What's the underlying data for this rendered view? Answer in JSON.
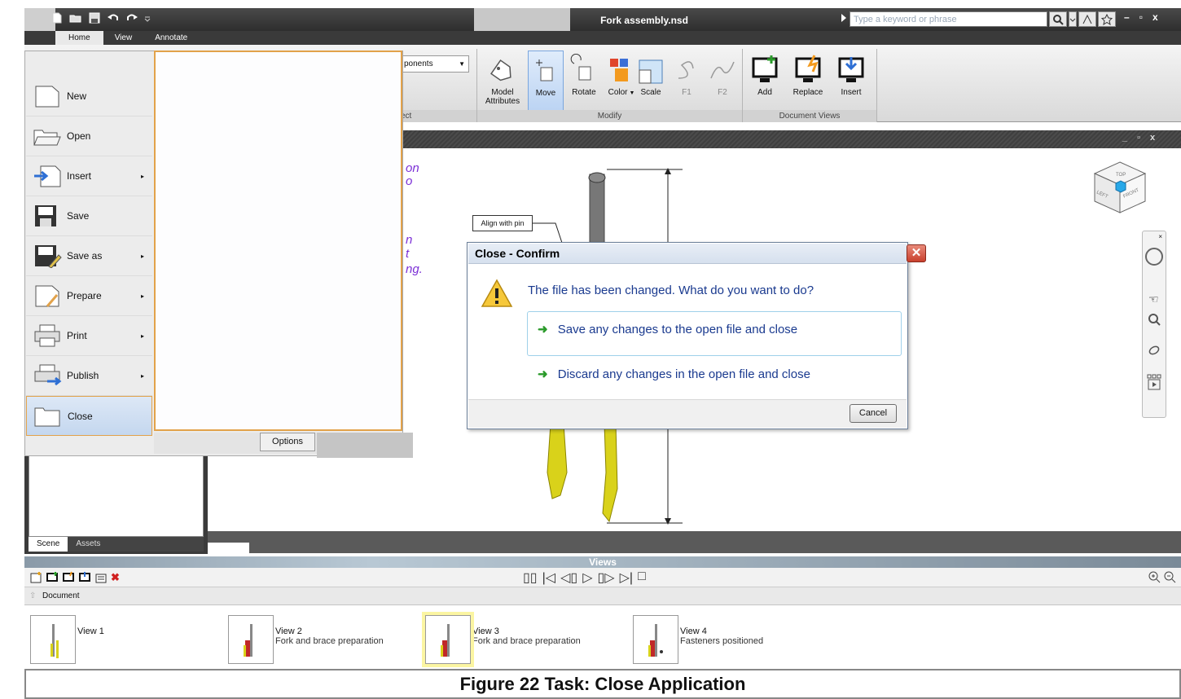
{
  "window": {
    "title": "Fork assembly.nsd",
    "search_placeholder": "Type a keyword or phrase"
  },
  "ribbon": {
    "tabs": [
      {
        "label": "Home"
      },
      {
        "label": "View"
      },
      {
        "label": "Annotate"
      }
    ],
    "components_combo": "ponents",
    "select_group_label_fragment": "ect",
    "modify_group": {
      "label": "Modify",
      "buttons": [
        {
          "label": "Model\nAttributes"
        },
        {
          "label": "Move"
        },
        {
          "label": "Rotate"
        },
        {
          "label": "Color"
        },
        {
          "label": "Scale"
        },
        {
          "label": "F1"
        },
        {
          "label": "F2"
        }
      ]
    },
    "document_views_group": {
      "label": "Document Views",
      "buttons": [
        {
          "label": "Add"
        },
        {
          "label": "Replace"
        },
        {
          "label": "Insert"
        }
      ]
    }
  },
  "backstage": {
    "items": [
      {
        "label": "New"
      },
      {
        "label": "Open"
      },
      {
        "label": "Insert"
      },
      {
        "label": "Save"
      },
      {
        "label": "Save as"
      },
      {
        "label": "Prepare"
      },
      {
        "label": "Print"
      },
      {
        "label": "Publish"
      },
      {
        "label": "Close"
      }
    ],
    "options_label": "Options"
  },
  "document": {
    "text_fragments": [
      "on",
      "o",
      "n",
      "t",
      "ng."
    ],
    "callout": "Align with pin"
  },
  "nav_cube": {
    "top": "TOP",
    "left": "LEFT",
    "front": "FRONT"
  },
  "left_pane": {
    "tabs": [
      {
        "label": "Scene"
      },
      {
        "label": "Assets"
      }
    ]
  },
  "dialog": {
    "title": "Close - Confirm",
    "question": "The file has been changed. What do you want to do?",
    "option_save": "Save any changes to the open file and close",
    "option_discard": "Discard any changes in the open file and close",
    "cancel_label": "Cancel"
  },
  "views": {
    "title": "Views",
    "breadcrumb": "Document",
    "cards": [
      {
        "name": "View 1",
        "sub": ""
      },
      {
        "name": "View 2",
        "sub": "Fork and brace preparation"
      },
      {
        "name": "View 3",
        "sub": "Fork and brace preparation"
      },
      {
        "name": "View 4",
        "sub": "Fasteners positioned"
      }
    ]
  },
  "caption": "Figure 22 Task: Close Application"
}
